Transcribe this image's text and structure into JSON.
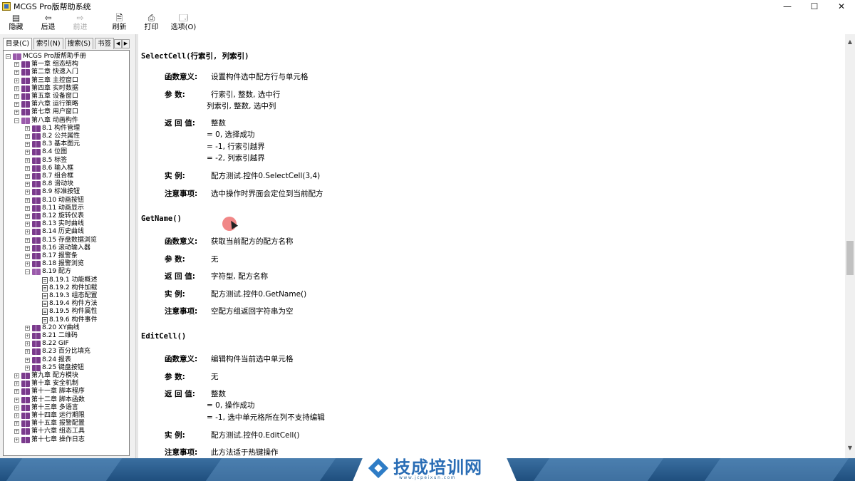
{
  "window": {
    "title": "MCGS Pro版帮助系统",
    "controls": {
      "minimize": "—",
      "maximize": "☐",
      "close": "✕"
    }
  },
  "toolbar": {
    "items": [
      {
        "label": "隐藏",
        "icon": "hide-pane-icon",
        "glyph": "▤",
        "enabled": true
      },
      {
        "label": "后退",
        "icon": "back-arrow-icon",
        "glyph": "⇦",
        "enabled": true
      },
      {
        "label": "前进",
        "icon": "forward-arrow-icon",
        "glyph": "⇨",
        "enabled": false
      },
      {
        "label": "刷新",
        "icon": "refresh-icon",
        "glyph": "🗎",
        "enabled": true
      },
      {
        "label": "打印",
        "icon": "printer-icon",
        "glyph": "⎙",
        "enabled": true
      },
      {
        "label": "选项(O)",
        "icon": "options-icon",
        "glyph": "🗔",
        "enabled": true
      }
    ]
  },
  "nav": {
    "tabs": [
      {
        "label": "目录(C)",
        "active": true
      },
      {
        "label": "索引(N)",
        "active": false
      },
      {
        "label": "搜索(S)",
        "active": false
      },
      {
        "label": "书签",
        "active": false
      }
    ],
    "tree": [
      {
        "label": "MCGS Pro版帮助手册",
        "level": 0,
        "exp": "-",
        "icon": "book-open"
      },
      {
        "label": "第一章 组态结构",
        "level": 1,
        "exp": "+",
        "icon": "book"
      },
      {
        "label": "第二章 快速入门",
        "level": 1,
        "exp": "+",
        "icon": "book"
      },
      {
        "label": "第三章 主控窗口",
        "level": 1,
        "exp": "+",
        "icon": "book"
      },
      {
        "label": "第四章 实时数据",
        "level": 1,
        "exp": "+",
        "icon": "book"
      },
      {
        "label": "第五章 设备窗口",
        "level": 1,
        "exp": "+",
        "icon": "book"
      },
      {
        "label": "第六章 运行策略",
        "level": 1,
        "exp": "+",
        "icon": "book"
      },
      {
        "label": "第七章 用户窗口",
        "level": 1,
        "exp": "+",
        "icon": "book"
      },
      {
        "label": "第八章 动画构件",
        "level": 1,
        "exp": "-",
        "icon": "book-open"
      },
      {
        "label": "8.1 构件管理",
        "level": 2,
        "exp": "+",
        "icon": "book"
      },
      {
        "label": "8.2 公共属性",
        "level": 2,
        "exp": "+",
        "icon": "book"
      },
      {
        "label": "8.3 基本图元",
        "level": 2,
        "exp": "+",
        "icon": "book"
      },
      {
        "label": "8.4 位图",
        "level": 2,
        "exp": "+",
        "icon": "book"
      },
      {
        "label": "8.5 标签",
        "level": 2,
        "exp": "+",
        "icon": "book"
      },
      {
        "label": "8.6 输入框",
        "level": 2,
        "exp": "+",
        "icon": "book"
      },
      {
        "label": "8.7 组合框",
        "level": 2,
        "exp": "+",
        "icon": "book"
      },
      {
        "label": "8.8 滑动块",
        "level": 2,
        "exp": "+",
        "icon": "book"
      },
      {
        "label": "8.9 标准按钮",
        "level": 2,
        "exp": "+",
        "icon": "book"
      },
      {
        "label": "8.10 动画按钮",
        "level": 2,
        "exp": "+",
        "icon": "book"
      },
      {
        "label": "8.11 动画显示",
        "level": 2,
        "exp": "+",
        "icon": "book"
      },
      {
        "label": "8.12 旋转仪表",
        "level": 2,
        "exp": "+",
        "icon": "book"
      },
      {
        "label": "8.13 实时曲线",
        "level": 2,
        "exp": "+",
        "icon": "book"
      },
      {
        "label": "8.14 历史曲线",
        "level": 2,
        "exp": "+",
        "icon": "book"
      },
      {
        "label": "8.15 存盘数据浏览",
        "level": 2,
        "exp": "+",
        "icon": "book"
      },
      {
        "label": "8.16 滚动输入器",
        "level": 2,
        "exp": "+",
        "icon": "book"
      },
      {
        "label": "8.17 报警条",
        "level": 2,
        "exp": "+",
        "icon": "book"
      },
      {
        "label": "8.18 报警浏览",
        "level": 2,
        "exp": "+",
        "icon": "book"
      },
      {
        "label": "8.19 配方",
        "level": 2,
        "exp": "-",
        "icon": "book-open"
      },
      {
        "label": "8.19.1 功能概述",
        "level": 3,
        "exp": "",
        "icon": "page"
      },
      {
        "label": "8.19.2 构件加载",
        "level": 3,
        "exp": "",
        "icon": "page"
      },
      {
        "label": "8.19.3 组态配置",
        "level": 3,
        "exp": "",
        "icon": "page"
      },
      {
        "label": "8.19.4 构件方法",
        "level": 3,
        "exp": "",
        "icon": "page"
      },
      {
        "label": "8.19.5 构件属性",
        "level": 3,
        "exp": "",
        "icon": "page"
      },
      {
        "label": "8.19.6 构件事件",
        "level": 3,
        "exp": "",
        "icon": "page"
      },
      {
        "label": "8.20 XY曲线",
        "level": 2,
        "exp": "+",
        "icon": "book"
      },
      {
        "label": "8.21 二维码",
        "level": 2,
        "exp": "+",
        "icon": "book"
      },
      {
        "label": "8.22 GIF",
        "level": 2,
        "exp": "+",
        "icon": "book"
      },
      {
        "label": "8.23 百分比填充",
        "level": 2,
        "exp": "+",
        "icon": "book"
      },
      {
        "label": "8.24 报表",
        "level": 2,
        "exp": "+",
        "icon": "book"
      },
      {
        "label": "8.25 键盘按钮",
        "level": 2,
        "exp": "+",
        "icon": "book"
      },
      {
        "label": "第九章 配方模块",
        "level": 1,
        "exp": "+",
        "icon": "book"
      },
      {
        "label": "第十章 安全机制",
        "level": 1,
        "exp": "+",
        "icon": "book"
      },
      {
        "label": "第十一章 脚本程序",
        "level": 1,
        "exp": "+",
        "icon": "book"
      },
      {
        "label": "第十二章 脚本函数",
        "level": 1,
        "exp": "+",
        "icon": "book"
      },
      {
        "label": "第十三章 多语言",
        "level": 1,
        "exp": "+",
        "icon": "book"
      },
      {
        "label": "第十四章 运行期限",
        "level": 1,
        "exp": "+",
        "icon": "book"
      },
      {
        "label": "第十五章 报警配置",
        "level": 1,
        "exp": "+",
        "icon": "book"
      },
      {
        "label": "第十六章 组态工具",
        "level": 1,
        "exp": "+",
        "icon": "book"
      },
      {
        "label": "第十七章 操作日志",
        "level": 1,
        "exp": "+",
        "icon": "book"
      }
    ]
  },
  "content": {
    "functions": [
      {
        "title": "SelectCell(行索引, 列索引)",
        "fields": [
          {
            "label": "函数意义:",
            "lines": [
              "设置构件选中配方行与单元格"
            ]
          },
          {
            "label": "参    数:",
            "lines": [
              "行索引, 整数, 选中行",
              "列索引, 整数, 选中列"
            ]
          },
          {
            "label": "返 回 值:",
            "lines": [
              "整数",
              "= 0, 选择成功",
              "= -1, 行索引越界",
              "= -2, 列索引越界"
            ]
          },
          {
            "label": "实    例:",
            "lines": [
              "配方测试.控件0.SelectCell(3,4)"
            ]
          },
          {
            "label": "注意事项:",
            "lines": [
              "选中操作时界面会定位到当前配方"
            ]
          }
        ]
      },
      {
        "title": "GetName()",
        "fields": [
          {
            "label": "函数意义:",
            "lines": [
              "获取当前配方的配方名称"
            ]
          },
          {
            "label": "参    数:",
            "lines": [
              "无"
            ]
          },
          {
            "label": "返 回 值:",
            "lines": [
              "字符型, 配方名称"
            ]
          },
          {
            "label": "实    例:",
            "lines": [
              "配方测试.控件0.GetName()"
            ]
          },
          {
            "label": "注意事项:",
            "lines": [
              "空配方组返回字符串为空"
            ]
          }
        ]
      },
      {
        "title": "EditCell()",
        "fields": [
          {
            "label": "函数意义:",
            "lines": [
              "编辑构件当前选中单元格"
            ]
          },
          {
            "label": "参    数:",
            "lines": [
              "无"
            ]
          },
          {
            "label": "返 回 值:",
            "lines": [
              "整数",
              "= 0, 操作成功",
              "= -1, 选中单元格所在列不支持编辑"
            ]
          },
          {
            "label": "实    例:",
            "lines": [
              "配方测试.控件0.EditCell()"
            ]
          },
          {
            "label": "注意事项:",
            "lines": [
              "此方法适于热键操作"
            ]
          }
        ]
      }
    ]
  },
  "banner": {
    "brand": "技成培训网",
    "url": "www.jcpeixun.com"
  },
  "colors": {
    "book": "#7a3a8c",
    "banner": "#1f4f7e",
    "brand": "#2a6db5"
  }
}
